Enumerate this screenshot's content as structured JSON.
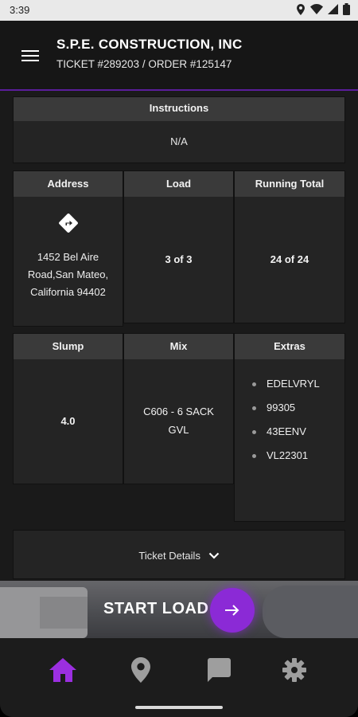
{
  "status_bar": {
    "time": "3:39"
  },
  "header": {
    "company": "S.P.E. CONSTRUCTION, INC",
    "ticket_line": "TICKET #289203 / ORDER #125147"
  },
  "instructions": {
    "title": "Instructions",
    "value": "N/A"
  },
  "summary": {
    "address_label": "Address",
    "address_lines": [
      "1452 Bel Aire",
      "Road,San Mateo,",
      "California 94402"
    ],
    "load_label": "Load",
    "load_value": "3 of 3",
    "running_total_label": "Running Total",
    "running_total_value": "24 of 24"
  },
  "specs": {
    "slump_label": "Slump",
    "slump_value": "4.0",
    "mix_label": "Mix",
    "mix_lines": [
      "C606 - 6 SACK",
      "GVL"
    ],
    "extras_label": "Extras",
    "extras": [
      "EDELVRYL",
      "99305",
      "43EENV",
      "VL22301"
    ]
  },
  "ticket_details": {
    "label": "Ticket Details"
  },
  "start_load": {
    "label": "START LOAD"
  },
  "bottom_nav": {
    "items": [
      {
        "icon": "home-icon",
        "active": true
      },
      {
        "icon": "location-pin-icon",
        "active": false
      },
      {
        "icon": "chat-icon",
        "active": false
      },
      {
        "icon": "settings-gear-icon",
        "active": false
      }
    ]
  },
  "colors": {
    "accent": "#8b2ad6",
    "active_nav": "#9b2fe0",
    "inactive_nav": "#9e9e9e"
  }
}
